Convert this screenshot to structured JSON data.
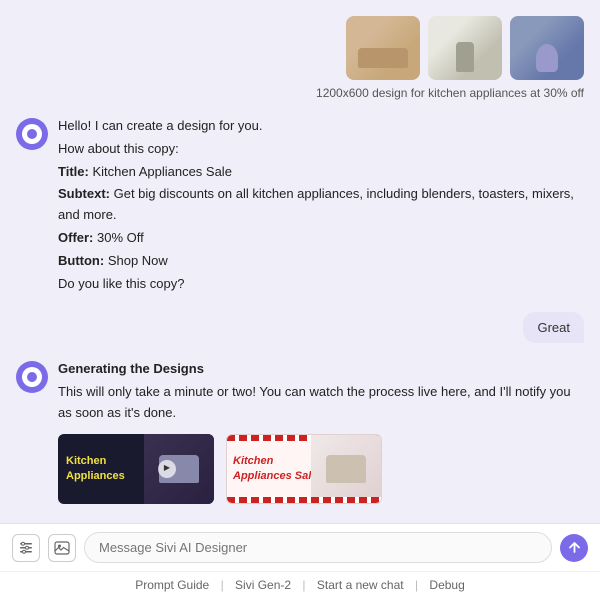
{
  "imagePreview": {
    "label": "1200x600 design for kitchen appliances at 30% off"
  },
  "botMessage1": {
    "lines": [
      {
        "text": "Hello! I can create a design for you."
      },
      {
        "text": "How about this copy:"
      },
      {
        "title_label": "Title:",
        "title_val": " Kitchen Appliances Sale"
      },
      {
        "subtext_label": "Subtext:",
        "subtext_val": " Get big discounts on all kitchen appliances, including blenders, toasters, mixers, and more."
      },
      {
        "offer_label": "Offer:",
        "offer_val": " 30% Off"
      },
      {
        "button_label": "Button:",
        "button_val": " Shop Now"
      },
      {
        "text": "Do you like this copy?"
      }
    ]
  },
  "userMessage": {
    "text": "Great"
  },
  "generatingSection": {
    "title": "Generating the Designs",
    "description": "This will only take a minute or two! You can watch the process live here, and I'll notify you as soon as it's done."
  },
  "designCards": [
    {
      "text": "Kitchen\nAppliances",
      "theme": "dark"
    },
    {
      "text": "Kitchen\nAppliances Sale",
      "theme": "light"
    }
  ],
  "inputBar": {
    "placeholder": "Message Sivi AI Designer"
  },
  "footer": {
    "links": [
      {
        "label": "Prompt Guide"
      },
      {
        "label": "Sivi Gen-2"
      },
      {
        "label": "Start a new chat"
      },
      {
        "label": "Debug"
      }
    ]
  }
}
